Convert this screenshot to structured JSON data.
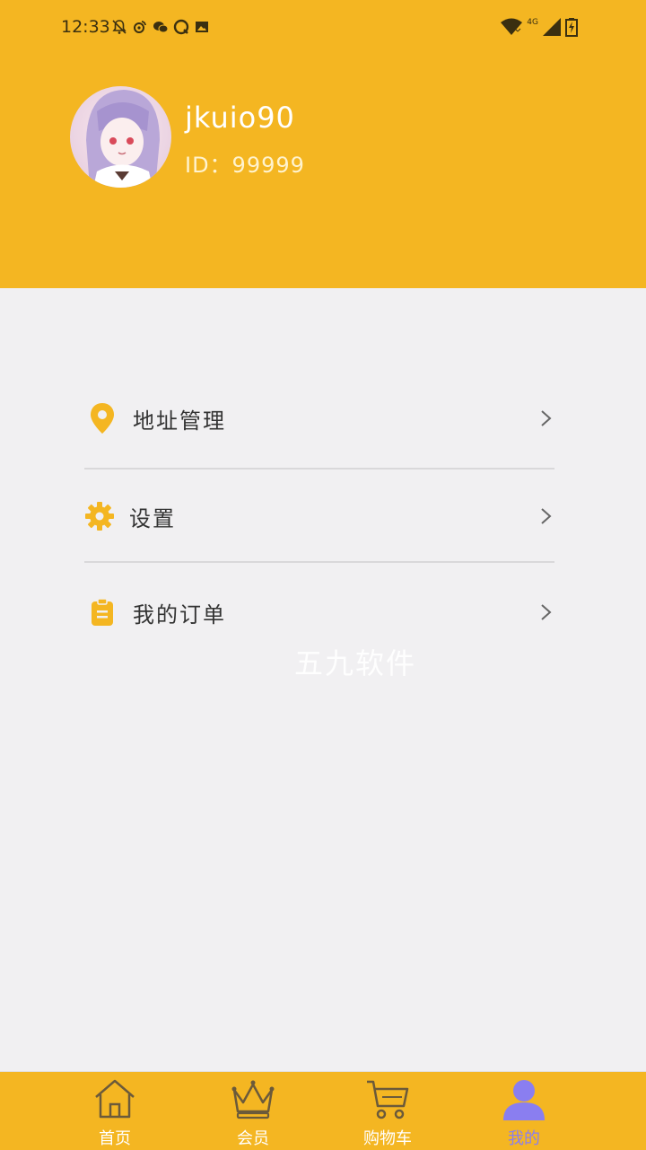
{
  "status_bar": {
    "time": "12:33",
    "network": "4G",
    "left_icons": [
      "bell-off-icon",
      "weibo-icon",
      "wechat-icon",
      "qq-icon",
      "image-icon"
    ],
    "right_icons": [
      "wifi-icon",
      "signal-icon",
      "battery-charging-icon"
    ]
  },
  "profile": {
    "username": "jkuio90",
    "id_text": "ID：99999"
  },
  "menu": [
    {
      "label": "地址管理",
      "icon": "location-pin-icon"
    },
    {
      "label": "设置",
      "icon": "gear-icon"
    },
    {
      "label": "我的订单",
      "icon": "clipboard-icon"
    }
  ],
  "watermark": "五九软件",
  "tabs": [
    {
      "label": "首页",
      "icon": "home-icon",
      "active": false
    },
    {
      "label": "会员",
      "icon": "crown-icon",
      "active": false
    },
    {
      "label": "购物车",
      "icon": "cart-icon",
      "active": false
    },
    {
      "label": "我的",
      "icon": "person-icon",
      "active": true
    }
  ],
  "colors": {
    "brand": "#F4B622",
    "background": "#F1F0F2",
    "active_tab": "#8A7EF0"
  }
}
